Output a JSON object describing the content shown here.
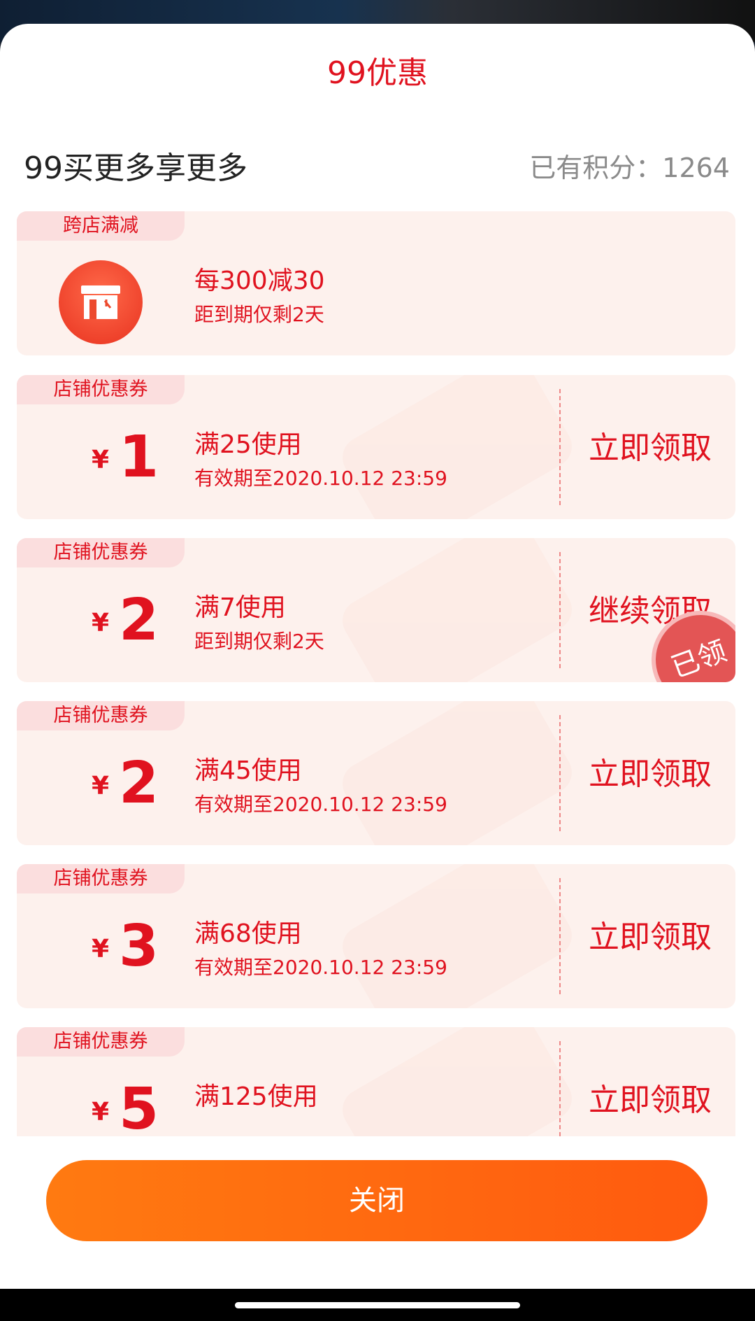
{
  "sheet": {
    "title": "99优惠",
    "subtitle": "99买更多享更多",
    "points_label": "已有积分：",
    "points_value": "1264"
  },
  "cross_store": {
    "tag": "跨店满减",
    "icon": "store-icon",
    "rule": "每300减30",
    "expiry": "距到期仅剩2天"
  },
  "coupons": [
    {
      "tag": "店铺优惠券",
      "currency": "¥",
      "amount": "1",
      "condition": "满25使用",
      "validity": "有效期至2020.10.12 23:59",
      "action": "立即领取",
      "claimed": false
    },
    {
      "tag": "店铺优惠券",
      "currency": "¥",
      "amount": "2",
      "condition": "满7使用",
      "validity": "距到期仅剩2天",
      "action": "继续领取",
      "claimed": true,
      "stamp": "已领"
    },
    {
      "tag": "店铺优惠券",
      "currency": "¥",
      "amount": "2",
      "condition": "满45使用",
      "validity": "有效期至2020.10.12 23:59",
      "action": "立即领取",
      "claimed": false
    },
    {
      "tag": "店铺优惠券",
      "currency": "¥",
      "amount": "3",
      "condition": "满68使用",
      "validity": "有效期至2020.10.12 23:59",
      "action": "立即领取",
      "claimed": false
    },
    {
      "tag": "店铺优惠券",
      "currency": "¥",
      "amount": "5",
      "condition": "满125使用",
      "validity": "",
      "action": "立即领取",
      "claimed": false
    }
  ],
  "footer": {
    "close_label": "关闭"
  },
  "colors": {
    "accent": "#e0121f",
    "card_bg": "#fdf1ed",
    "tag_bg": "#fbdede",
    "button_start": "#ff7a11",
    "button_end": "#ff5a0f"
  }
}
